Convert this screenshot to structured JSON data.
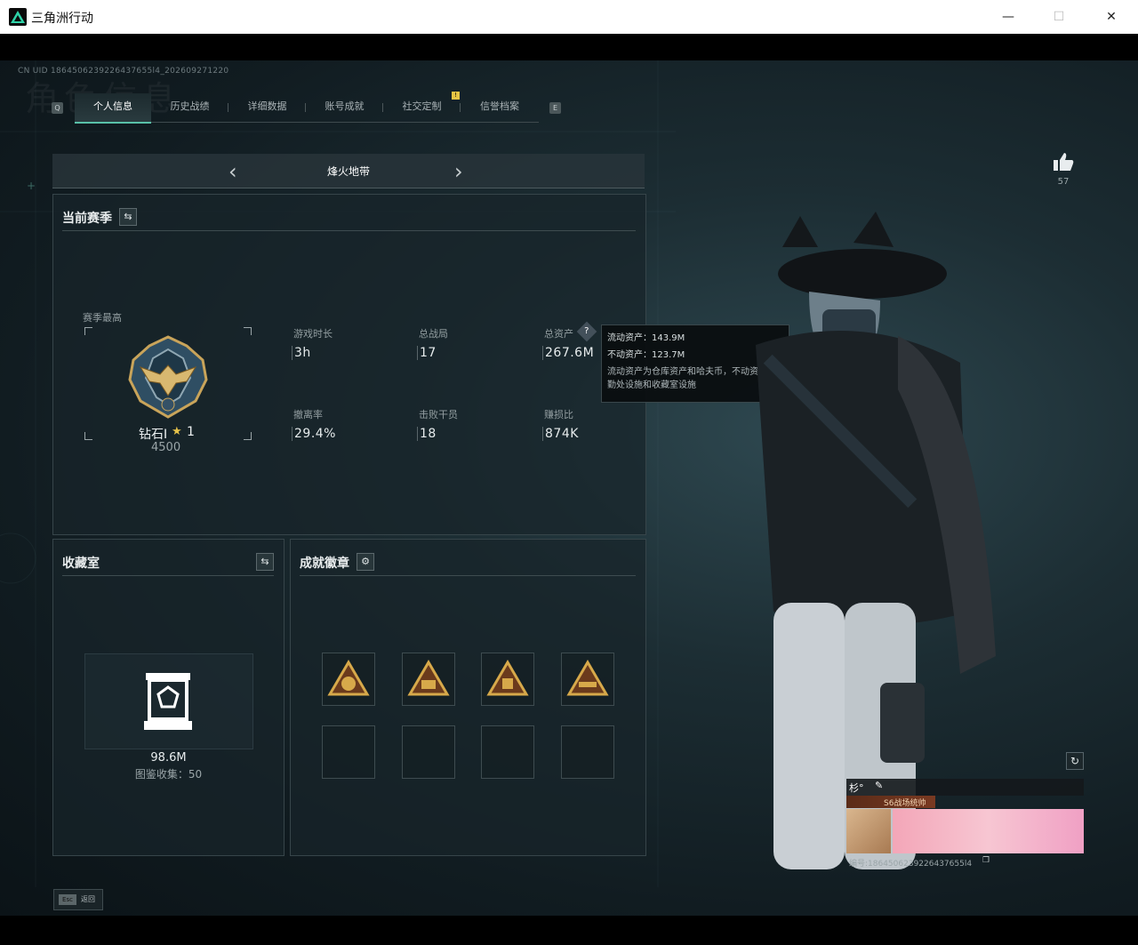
{
  "window": {
    "title": "三角洲行动",
    "minimize": "—",
    "maximize": "☐",
    "close": "✕"
  },
  "uid": "CN UID 1864506239226437655l4_202609271220",
  "bg_heading": "角色信息",
  "tabs": {
    "left_key": "Q",
    "right_key": "E",
    "badge": "!",
    "items": [
      {
        "label": "个人信息",
        "active": true
      },
      {
        "label": "历史战绩",
        "active": false
      },
      {
        "label": "详细数据",
        "active": false
      },
      {
        "label": "账号成就",
        "active": false
      },
      {
        "label": "社交定制",
        "active": false
      },
      {
        "label": "信誉档案",
        "active": false
      }
    ]
  },
  "mode": {
    "label": "烽火地带",
    "prev": "‹",
    "next": "›"
  },
  "season": {
    "title": "当前赛季",
    "swap_icon": "⇆",
    "peak_label": "赛季最高",
    "rank_name": "钻石Ⅰ",
    "rank_star": "1",
    "rank_score": "4500",
    "stats": [
      {
        "label": "游戏时长",
        "value": "3h"
      },
      {
        "label": "总战局",
        "value": "17"
      },
      {
        "label": "总资产",
        "value": "267.6M"
      },
      {
        "label": "撤离率",
        "value": "29.4%"
      },
      {
        "label": "击败干员",
        "value": "18"
      },
      {
        "label": "赚损比",
        "value": "874K"
      }
    ]
  },
  "tooltip": {
    "line1": "流动资产：143.9M",
    "line2": "不动资产：123.7M",
    "desc": "流动资产为仓库资产和哈夫币，不动资产为特勤处设施和收藏室设施"
  },
  "collection": {
    "title": "收藏室",
    "swap_icon": "⇆",
    "value": "98.6M",
    "count_text": "图鉴收集：50"
  },
  "achievements": {
    "title": "成就徽章",
    "gear_icon": "⚙"
  },
  "likes": {
    "count": "57"
  },
  "card": {
    "name": "杉°",
    "badge_text": "S6战场统帅",
    "id_text": "编号:1864506239226437655l4"
  },
  "esc": {
    "key": "Esc",
    "label": "返回"
  }
}
